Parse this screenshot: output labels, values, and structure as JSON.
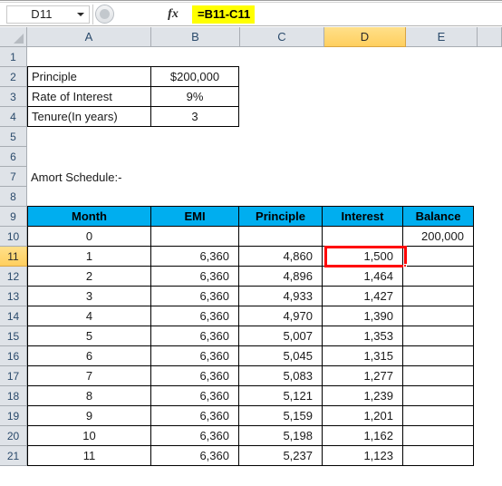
{
  "formula_bar": {
    "name_box_value": "D11",
    "fx_label": "fx",
    "formula_value": "=B11-C11",
    "highlight_color": "#ffff00"
  },
  "grid": {
    "column_headers": [
      "A",
      "B",
      "C",
      "D",
      "E"
    ],
    "active_column": "D",
    "active_row": "11",
    "row_numbers": [
      "1",
      "2",
      "3",
      "4",
      "5",
      "6",
      "7",
      "8",
      "9",
      "10",
      "11",
      "12",
      "13",
      "14",
      "15",
      "16",
      "17",
      "18",
      "19",
      "20",
      "21"
    ],
    "header_fill_color": "#00aeef",
    "selection_color": "#ff0000"
  },
  "inputs_table": {
    "rows": [
      {
        "label": "Principle",
        "value": "$200,000"
      },
      {
        "label": "Rate of Interest",
        "value": "9%"
      },
      {
        "label": "Tenure(In years)",
        "value": "3"
      }
    ]
  },
  "section_title": "Amort Schedule:-",
  "schedule": {
    "headers": [
      "Month",
      "EMI",
      "Principle",
      "Interest",
      "Balance"
    ],
    "rows": [
      {
        "month": "0",
        "emi": "",
        "principle": "",
        "interest": "",
        "balance": "200,000"
      },
      {
        "month": "1",
        "emi": "6,360",
        "principle": "4,860",
        "interest": "1,500",
        "balance": ""
      },
      {
        "month": "2",
        "emi": "6,360",
        "principle": "4,896",
        "interest": "1,464",
        "balance": ""
      },
      {
        "month": "3",
        "emi": "6,360",
        "principle": "4,933",
        "interest": "1,427",
        "balance": ""
      },
      {
        "month": "4",
        "emi": "6,360",
        "principle": "4,970",
        "interest": "1,390",
        "balance": ""
      },
      {
        "month": "5",
        "emi": "6,360",
        "principle": "5,007",
        "interest": "1,353",
        "balance": ""
      },
      {
        "month": "6",
        "emi": "6,360",
        "principle": "5,045",
        "interest": "1,315",
        "balance": ""
      },
      {
        "month": "7",
        "emi": "6,360",
        "principle": "5,083",
        "interest": "1,277",
        "balance": ""
      },
      {
        "month": "8",
        "emi": "6,360",
        "principle": "5,121",
        "interest": "1,239",
        "balance": ""
      },
      {
        "month": "9",
        "emi": "6,360",
        "principle": "5,159",
        "interest": "1,201",
        "balance": ""
      },
      {
        "month": "10",
        "emi": "6,360",
        "principle": "5,198",
        "interest": "1,162",
        "balance": ""
      },
      {
        "month": "11",
        "emi": "6,360",
        "principle": "5,237",
        "interest": "1,123",
        "balance": ""
      }
    ]
  }
}
